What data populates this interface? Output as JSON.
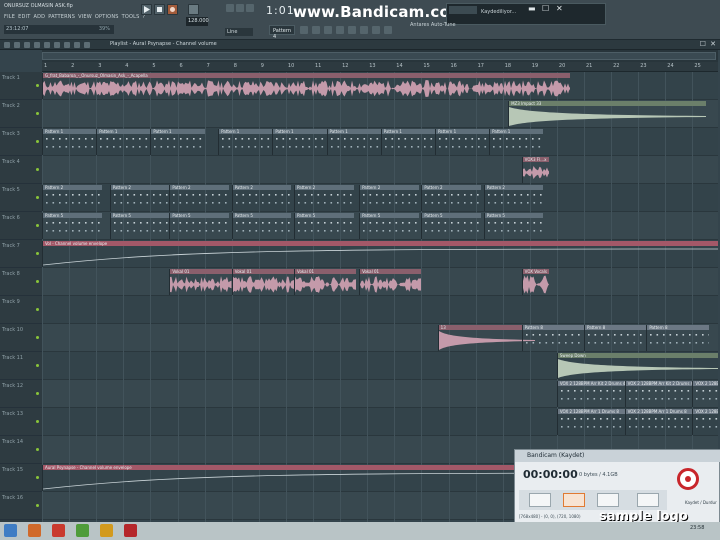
{
  "app": {
    "project_title": "ONURSUZ OLMASIN ASK.flp",
    "menu": [
      "FILE",
      "EDIT",
      "ADD",
      "PATTERNS",
      "VIEW",
      "OPTIONS",
      "TOOLS",
      "?"
    ],
    "hint_time": "23:12:07",
    "hint_pct": "39%"
  },
  "transport": {
    "bpm": "128.000",
    "song_position": "1:01",
    "snap": "Line",
    "pattern": "Pattern 4"
  },
  "monitor": {
    "label": "Kaydediliyor...",
    "plugin": "Antares Auto-Tune"
  },
  "watermark": "www.Bandicam.com",
  "playlist": {
    "title": "Playlist - Aural Psynapse - Channel volume",
    "ruler": [
      "1",
      "2",
      "3",
      "4",
      "5",
      "6",
      "7",
      "8",
      "9",
      "10",
      "11",
      "12",
      "13",
      "14",
      "15",
      "16",
      "17",
      "18",
      "19",
      "20",
      "21",
      "22",
      "23",
      "24",
      "25"
    ],
    "tracks": [
      {
        "name": "Track 1"
      },
      {
        "name": "Track 2"
      },
      {
        "name": "Track 3"
      },
      {
        "name": "Track 4"
      },
      {
        "name": "Track 5"
      },
      {
        "name": "Track 6"
      },
      {
        "name": "Track 7"
      },
      {
        "name": "Track 8"
      },
      {
        "name": "Track 9"
      },
      {
        "name": "Track 10"
      },
      {
        "name": "Track 11"
      },
      {
        "name": "Track 12"
      },
      {
        "name": "Track 13"
      },
      {
        "name": "Track 14"
      },
      {
        "name": "Track 15"
      },
      {
        "name": "Track 16"
      }
    ],
    "clip_labels": {
      "vocal": "G_frat_Babaroa_-_Onursuz_Olmasin_Ask_-_Acapella",
      "impact": "MZ3 Impact 33",
      "pattern1": "Pattern 1",
      "pattern2": "Pattern 2",
      "pattern5": "Pattern 5",
      "voxfx": "VOX3 FI...x",
      "auto1": "Vol - Channel volume envelope",
      "vokal": "Vokal 01",
      "vox_vocal": "VOX Vocals",
      "num13": "13",
      "pattern8": "Pattern 8",
      "sweep": "Sweep Down",
      "vox_loop": "VOX 2 128BPM Arr Kit 2 Drums 4-8",
      "vox_loop2": "VOX 2 128BPM Arr 1 Drums 8",
      "auto2": "Aural Psynapse - Channel volume envelope"
    }
  },
  "bandicam": {
    "title": "Bandicam (Kaydet)",
    "time": "00:00:00",
    "size": "0 bytes / 4.1GB",
    "rec_label": "Kaydet / Durdur",
    "status": "[768x480] - (0, 0), (720, 1080)",
    "logo": "sample logo"
  },
  "taskbar": {
    "time": "23:58"
  },
  "colors": {
    "accent_record": "#c8262b",
    "clip_audio": "#8a5f6c",
    "clip_pattern": "#5f6f7a",
    "clip_impact": "#6b7f6a"
  }
}
